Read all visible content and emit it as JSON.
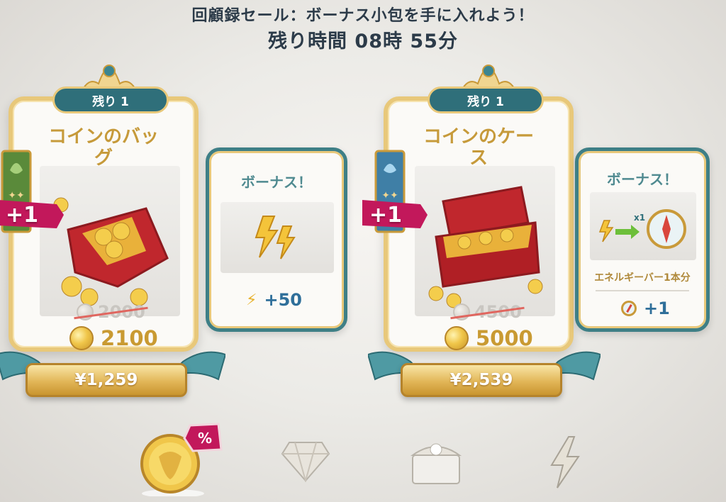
{
  "header": {
    "subtitle": "回顧録セール：ボーナス小包を手に入れよう！",
    "timer": "残り時間 08時 55分"
  },
  "offers": [
    {
      "remaining": "残り 1",
      "title": "コインのバッグ",
      "old_amount": "2000",
      "new_amount": "2100",
      "price": "¥1,259",
      "plus_badge": "+1",
      "bonus": {
        "title": "ボーナス！",
        "value": "+50",
        "icon": "lightning-icon"
      }
    },
    {
      "remaining": "残り 1",
      "title": "コインのケース",
      "old_amount": "4500",
      "new_amount": "5000",
      "price": "¥2,539",
      "plus_badge": "+1",
      "bonus": {
        "title": "ボーナス！",
        "caption": "エネルギーバー1本分",
        "value": "+1",
        "art_multiplier": "x1",
        "icon": "compass-icon"
      }
    }
  ],
  "nav": {
    "items": [
      "coin-sale-icon",
      "diamond-icon",
      "chest-icon",
      "energy-icon"
    ],
    "sale_badge": "%"
  },
  "colors": {
    "gold": "#e8c87a",
    "teal": "#2f6f7a",
    "title_gold": "#c69a3a",
    "header_text": "#2c3b49"
  }
}
